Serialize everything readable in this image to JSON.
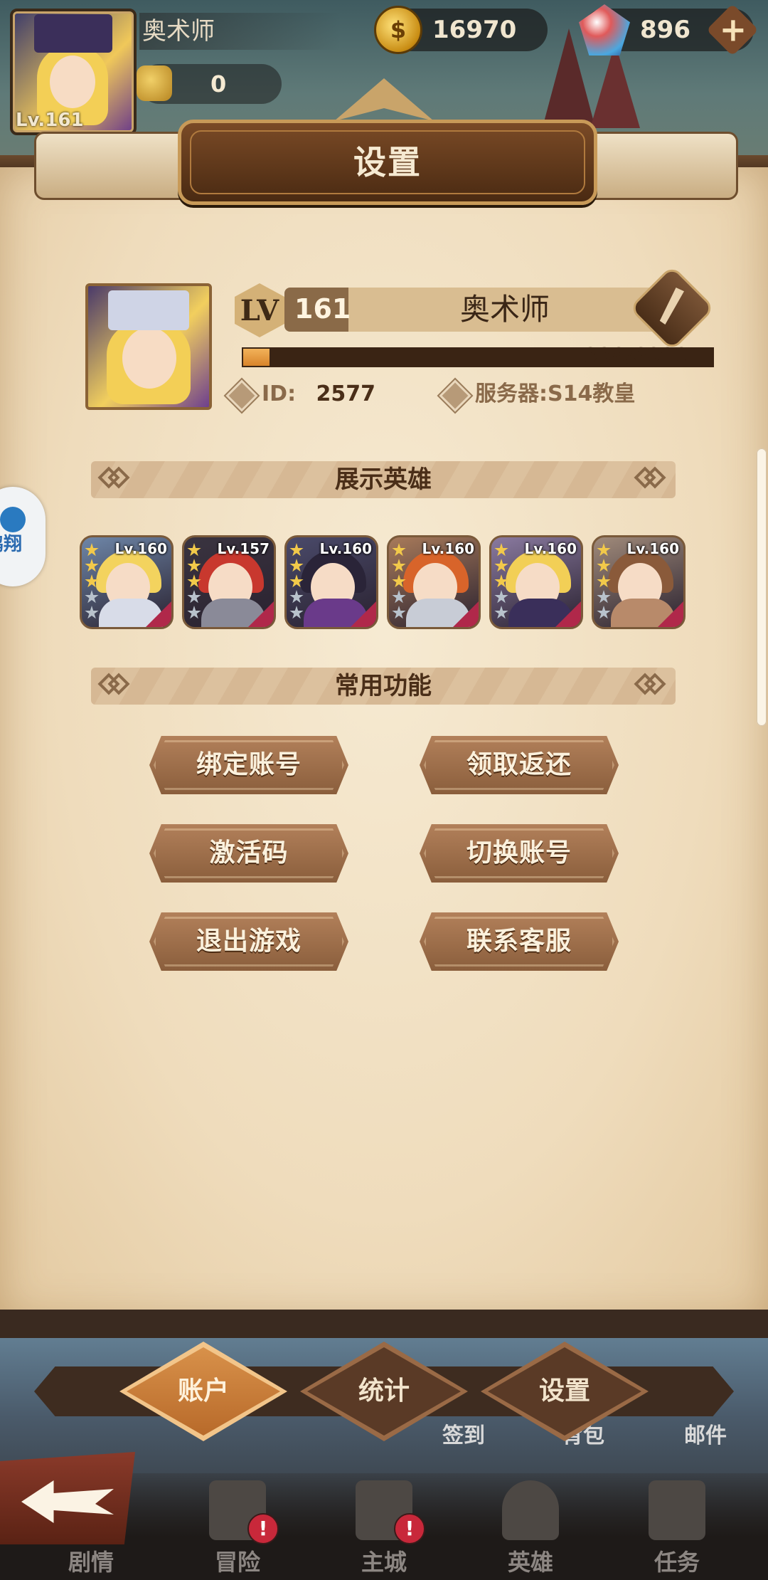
{
  "hud": {
    "player_name": "奥术师",
    "avatar_level": "Lv.161",
    "power": "0",
    "gold": "16970",
    "gold_icon": "coin-icon",
    "gems": "896",
    "gem_icon": "gem-icon",
    "add_symbol": "+"
  },
  "title": "设置",
  "profile": {
    "lv_badge": "LV",
    "level": "161",
    "name": "奥术师",
    "xp": "338/6000",
    "xp_fraction": 0.056,
    "id_label": "ID:",
    "id_value": "2577",
    "server_label": "服务器:",
    "server_value": "S14教皇"
  },
  "showcase": {
    "title": "展示英雄",
    "heroes": [
      {
        "level": "Lv.160",
        "hair": "#f3d35e",
        "body": "#d8dce8",
        "bg": "#6e86a8"
      },
      {
        "level": "Lv.157",
        "hair": "#c8382e",
        "body": "#8a8a98",
        "bg": "#3a3440"
      },
      {
        "level": "Lv.160",
        "hair": "#2a2438",
        "body": "#6a3a8a",
        "bg": "#4a4a6a"
      },
      {
        "level": "Lv.160",
        "hair": "#d8642a",
        "body": "#c8ccd6",
        "bg": "#a87a5a"
      },
      {
        "level": "Lv.160",
        "hair": "#f2cf56",
        "body": "#3a2f5a",
        "bg": "#8a7aa0"
      },
      {
        "level": "Lv.160",
        "hair": "#8a5a3a",
        "body": "#b88a6a",
        "bg": "#a08a7a"
      }
    ]
  },
  "functions": {
    "title": "常用功能",
    "buttons": [
      "绑定账号",
      "领取返还",
      "激活码",
      "切换账号",
      "退出游戏",
      "联系客服"
    ]
  },
  "floating": {
    "label": "鹏翔"
  },
  "tabs": {
    "items": [
      "账户",
      "统计",
      "设置"
    ],
    "active": 0
  },
  "underlay": {
    "checkin": "签到",
    "bag": "背包",
    "mail": "邮件"
  },
  "nav": {
    "items": [
      "剧情",
      "冒险",
      "主城",
      "英雄",
      "任务"
    ],
    "alert": "!"
  }
}
